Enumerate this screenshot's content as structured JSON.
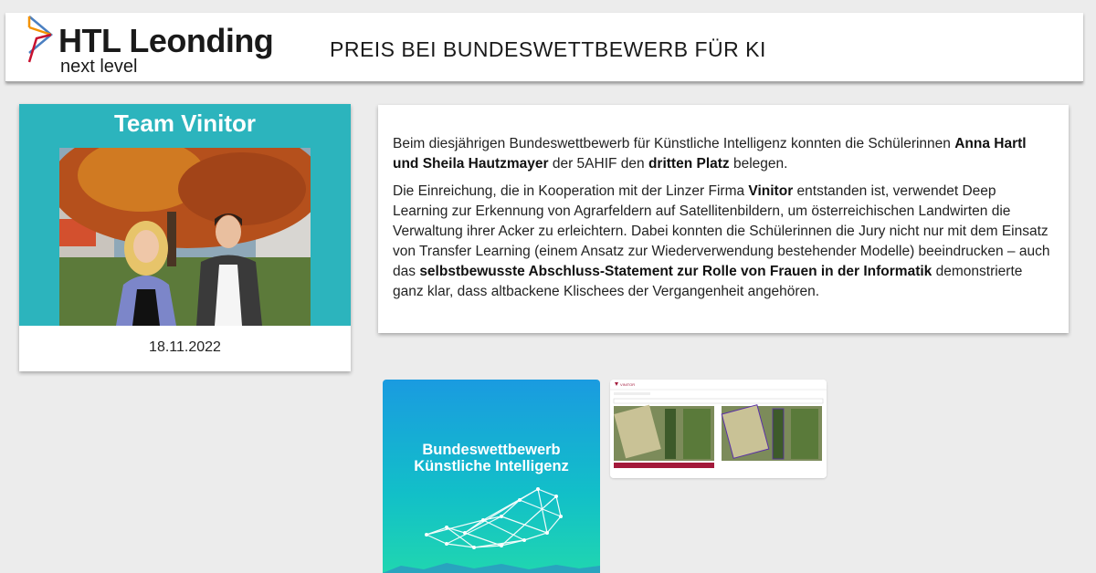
{
  "header": {
    "logo_title": "HTL Leonding",
    "logo_subtitle": "next level",
    "page_title": "PREIS BEI BUNDESWETTBEWERB FÜR KI"
  },
  "card": {
    "image_title": "Team Vinitor",
    "date": "18.11.2022"
  },
  "article": {
    "p1": [
      {
        "t": "Beim diesjährigen Bundeswettbewerb für Künstliche Intelligenz konnten die Schülerinnen ",
        "b": false
      },
      {
        "t": "Anna Hartl und Sheila Hautzmayer",
        "b": true
      },
      {
        "t": " der 5AHIF den ",
        "b": false
      },
      {
        "t": "dritten Platz",
        "b": true
      },
      {
        "t": " belegen.",
        "b": false
      }
    ],
    "p2": [
      {
        "t": "Die Einreichung, die in Kooperation mit der Linzer Firma ",
        "b": false
      },
      {
        "t": "Vinitor",
        "b": true
      },
      {
        "t": " entstanden ist, verwendet Deep Learning zur Erkennung von Agrarfeldern auf Satellitenbildern, um österreichischen Landwirten die Verwaltung ihrer Acker zu erleichtern. Dabei konnten die Schülerinnen die Jury nicht nur mit dem Einsatz von Transfer Learning (einem Ansatz zur Wiederverwendung bestehender Modelle) beeindrucken – auch das ",
        "b": false
      },
      {
        "t": "selbstbewusste Abschluss-Statement zur Rolle von Frauen in der Informatik",
        "b": true
      },
      {
        "t": " demonstrierte ganz klar, dass altbackene Klischees der Vergangenheit angehören.",
        "b": false
      }
    ]
  },
  "gallery": {
    "poster_title_line1": "Bundeswettbewerb",
    "poster_title_line2": "Künstliche Intelligenz",
    "screenshot_brand": "VINITOR"
  },
  "colors": {
    "teal": "#2cb4bd",
    "logo_orange": "#f39200",
    "logo_red": "#c8102e",
    "logo_blue": "#4a7fc1",
    "accent_red": "#a3193b"
  }
}
